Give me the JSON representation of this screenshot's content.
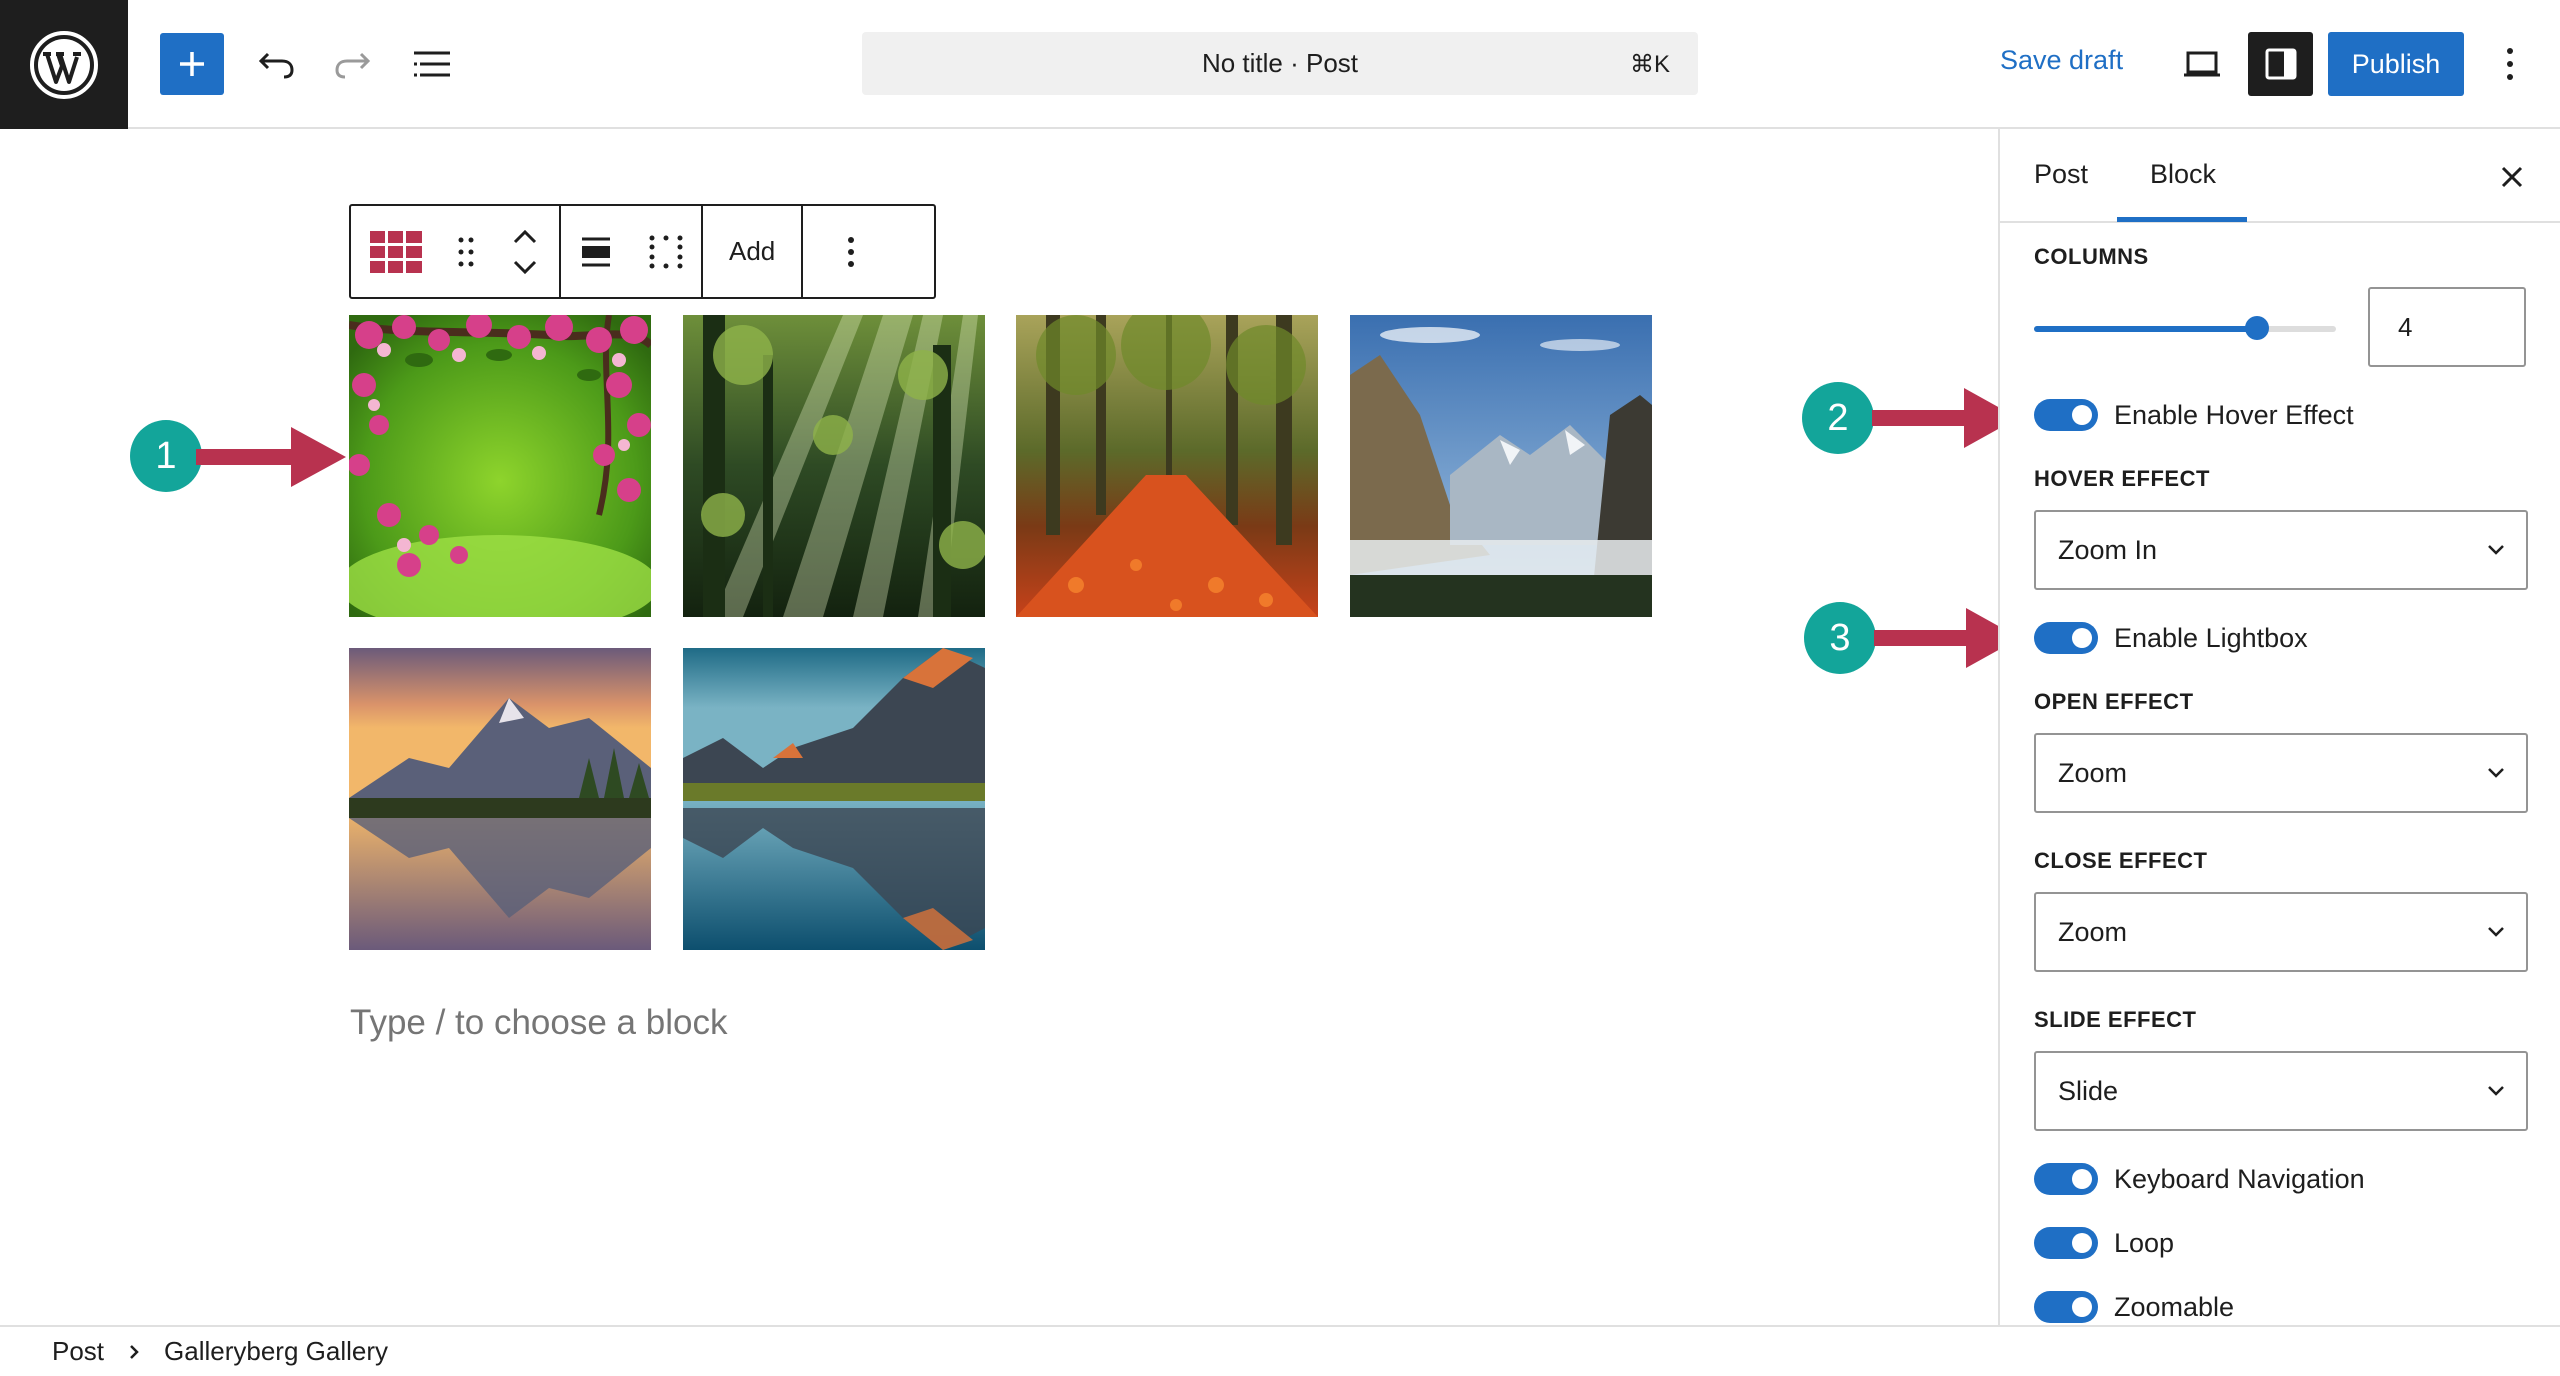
{
  "header": {
    "command_center": "No title · Post",
    "shortcut": "⌘K",
    "save_draft": "Save draft",
    "publish": "Publish"
  },
  "block_toolbar": {
    "add_label": "Add"
  },
  "gallery": {
    "images": [
      {
        "name": "flower-branch-image"
      },
      {
        "name": "forest-sunrays-image"
      },
      {
        "name": "autumn-forest-path-image"
      },
      {
        "name": "valley-cliffs-image"
      },
      {
        "name": "mountain-lake-sunset-image"
      },
      {
        "name": "mountain-lake-reflection-image"
      }
    ]
  },
  "editor": {
    "placeholder": "Type / to choose a block"
  },
  "annotations": {
    "badge_1": "1",
    "badge_2": "2",
    "badge_3": "3",
    "badge_color": "#13a59a",
    "arrow_color": "#b8324f"
  },
  "sidebar": {
    "tab_post": "Post",
    "tab_block": "Block",
    "columns_label": "COLUMNS",
    "columns_value": "4",
    "columns_slider_fraction": 0.74,
    "enable_hover_effect": "Enable Hover Effect",
    "hover_effect_label": "HOVER EFFECT",
    "hover_effect_value": "Zoom In",
    "enable_lightbox": "Enable Lightbox",
    "open_effect_label": "OPEN EFFECT",
    "open_effect_value": "Zoom",
    "close_effect_label": "CLOSE EFFECT",
    "close_effect_value": "Zoom",
    "slide_effect_label": "SLIDE EFFECT",
    "slide_effect_value": "Slide",
    "keyboard_navigation": "Keyboard Navigation",
    "loop": "Loop",
    "zoomable": "Zoomable"
  },
  "breadcrumb": {
    "root": "Post",
    "current": "Galleryberg Gallery"
  },
  "colors": {
    "accent": "#1f6fc5",
    "dark": "#1e1e1e"
  }
}
